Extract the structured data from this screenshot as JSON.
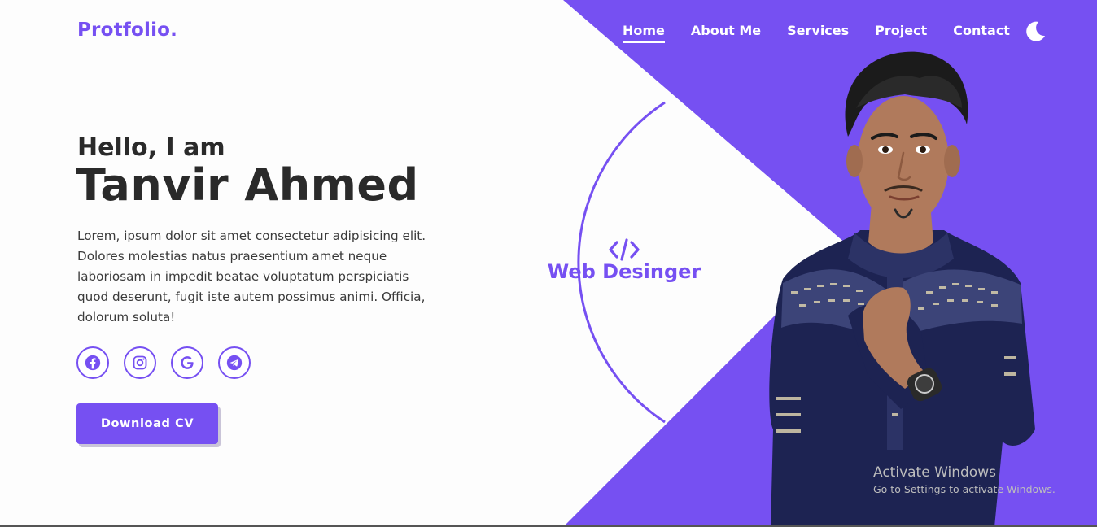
{
  "logo": "Protfolio.",
  "nav": {
    "items": [
      "Home",
      "About Me",
      "Services",
      "Project",
      "Contact"
    ],
    "active": "Home"
  },
  "theme_toggle_icon": "moon-icon",
  "hero": {
    "greeting": "Hello, I am",
    "name": "Tanvir Ahmed",
    "bio": "Lorem, ipsum dolor sit amet consectetur adipisicing elit. Dolores molestias natus praesentium amet neque laboriosam in impedit beatae voluptatum perspiciatis quod deserunt, fugit iste autem possimus animi. Officia, dolorum soluta!",
    "socials": [
      "facebook-icon",
      "instagram-icon",
      "google-icon",
      "telegram-icon"
    ],
    "cv_button": "Download CV"
  },
  "role": {
    "icon": "code-icon",
    "label": "Web Desinger"
  },
  "watermark": {
    "title": "Activate Windows",
    "subtitle": "Go to Settings to activate Windows."
  },
  "colors": {
    "accent": "#7650f2",
    "text_dark": "#2a2a2a",
    "background": "#fdfdfd"
  }
}
